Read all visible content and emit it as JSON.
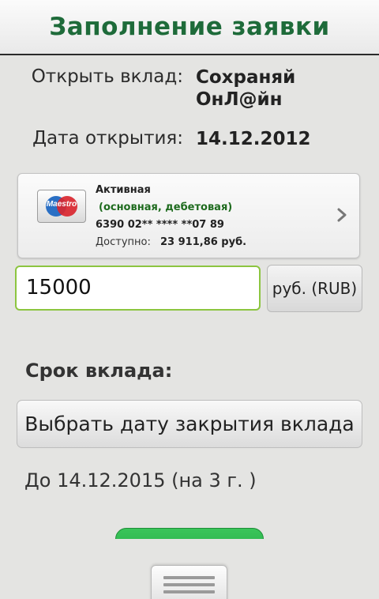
{
  "header": {
    "title": "Заполнение заявки"
  },
  "deposit": {
    "open_label": "Открыть вклад:",
    "name_line1": "Сохраняй",
    "name_line2": "ОнЛ@йн",
    "date_label": "Дата открытия:",
    "date_value": "14.12.2012"
  },
  "card": {
    "brand": "Maestro",
    "status": "Активная",
    "type": "(основная, дебетовая)",
    "number": "6390 02** **** **07 89",
    "available_label": "Доступно:",
    "available_value": "23 911,86 руб."
  },
  "amount": {
    "value": "15000",
    "currency_label": "руб. (RUB)"
  },
  "term": {
    "title": "Срок вклада:",
    "choose_button": "Выбрать дату закрытия вклада",
    "until_text": "До 14.12.2015 (на 3 г. )"
  },
  "colors": {
    "accent_green": "#1e6b3a",
    "input_border": "#8cc540",
    "button_green": "#23a443"
  }
}
